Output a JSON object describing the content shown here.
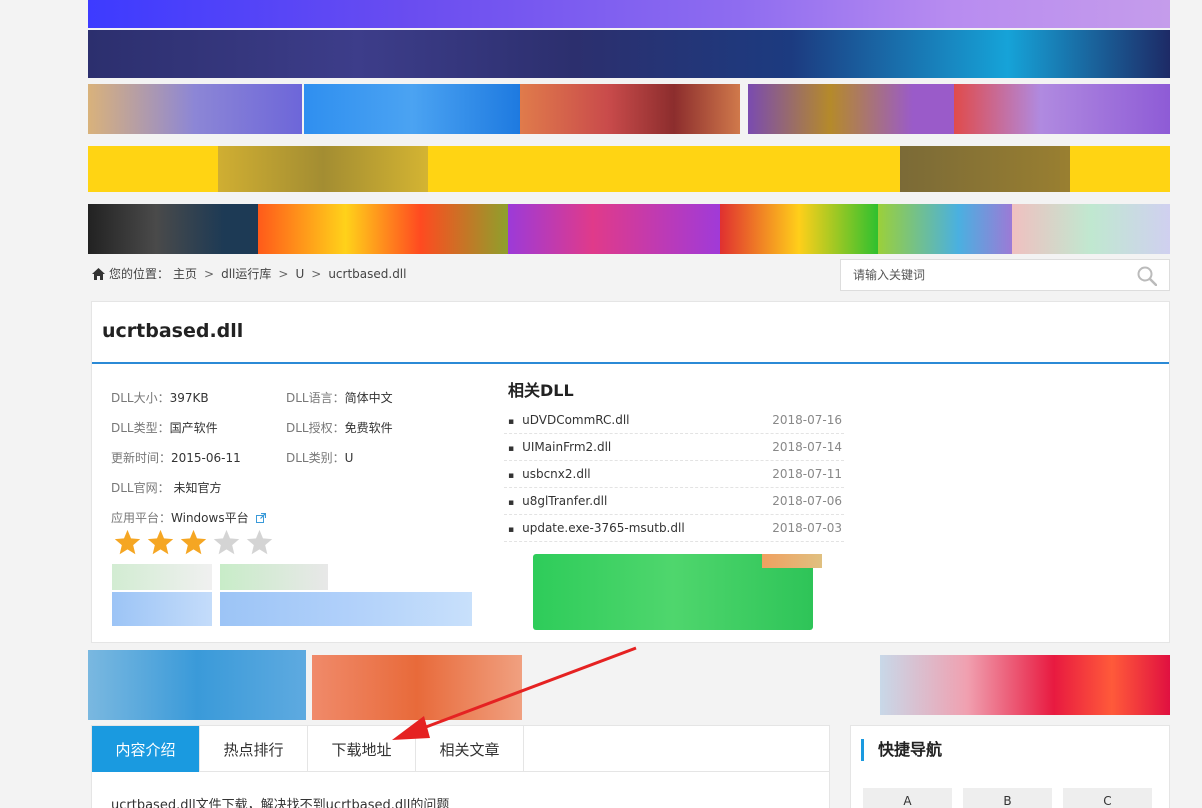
{
  "breadcrumb": {
    "prefix": "您的位置：",
    "items": [
      "主页",
      "dll运行库",
      "U",
      "ucrtbased.dll"
    ]
  },
  "search": {
    "placeholder": "请输入关键词"
  },
  "file": {
    "title": "ucrtbased.dll",
    "info": [
      [
        {
          "label": "DLL大小：",
          "value": "397KB"
        },
        {
          "label": "DLL语言：",
          "value": "简体中文"
        }
      ],
      [
        {
          "label": "DLL类型：",
          "value": "国产软件"
        },
        {
          "label": "DLL授权：",
          "value": "免费软件"
        }
      ],
      [
        {
          "label": "更新时间：",
          "value": "2015-06-11"
        },
        {
          "label": "DLL类别：",
          "value": "U"
        }
      ],
      [
        {
          "label": "DLL官网：",
          "value": " 未知官方"
        }
      ],
      [
        {
          "label": "应用平台：",
          "value": "Windows平台"
        }
      ]
    ],
    "rating": {
      "value": 3,
      "max": 5
    }
  },
  "related": {
    "title": "相关DLL",
    "items": [
      {
        "name": "uDVDCommRC.dll",
        "date": "2018-07-16"
      },
      {
        "name": "UIMainFrm2.dll",
        "date": "2018-07-14"
      },
      {
        "name": "usbcnx2.dll",
        "date": "2018-07-11"
      },
      {
        "name": "u8glTranfer.dll",
        "date": "2018-07-06"
      },
      {
        "name": "update.exe-3765-msutb.dll",
        "date": "2018-07-03"
      }
    ]
  },
  "tabs": [
    "内容介绍",
    "热点排行",
    "下载地址",
    "相关文章"
  ],
  "intro_text": "ucrtbased.dll文件下载，解决找不到ucrtbased.dll的问题",
  "quick_nav": {
    "title": "快捷导航",
    "letters": [
      "A",
      "B",
      "C"
    ]
  },
  "colors": {
    "accent": "#1a9ae0",
    "title_rule": "#2b8ad6",
    "star": "#f5a623",
    "arrow": "#e52222"
  }
}
